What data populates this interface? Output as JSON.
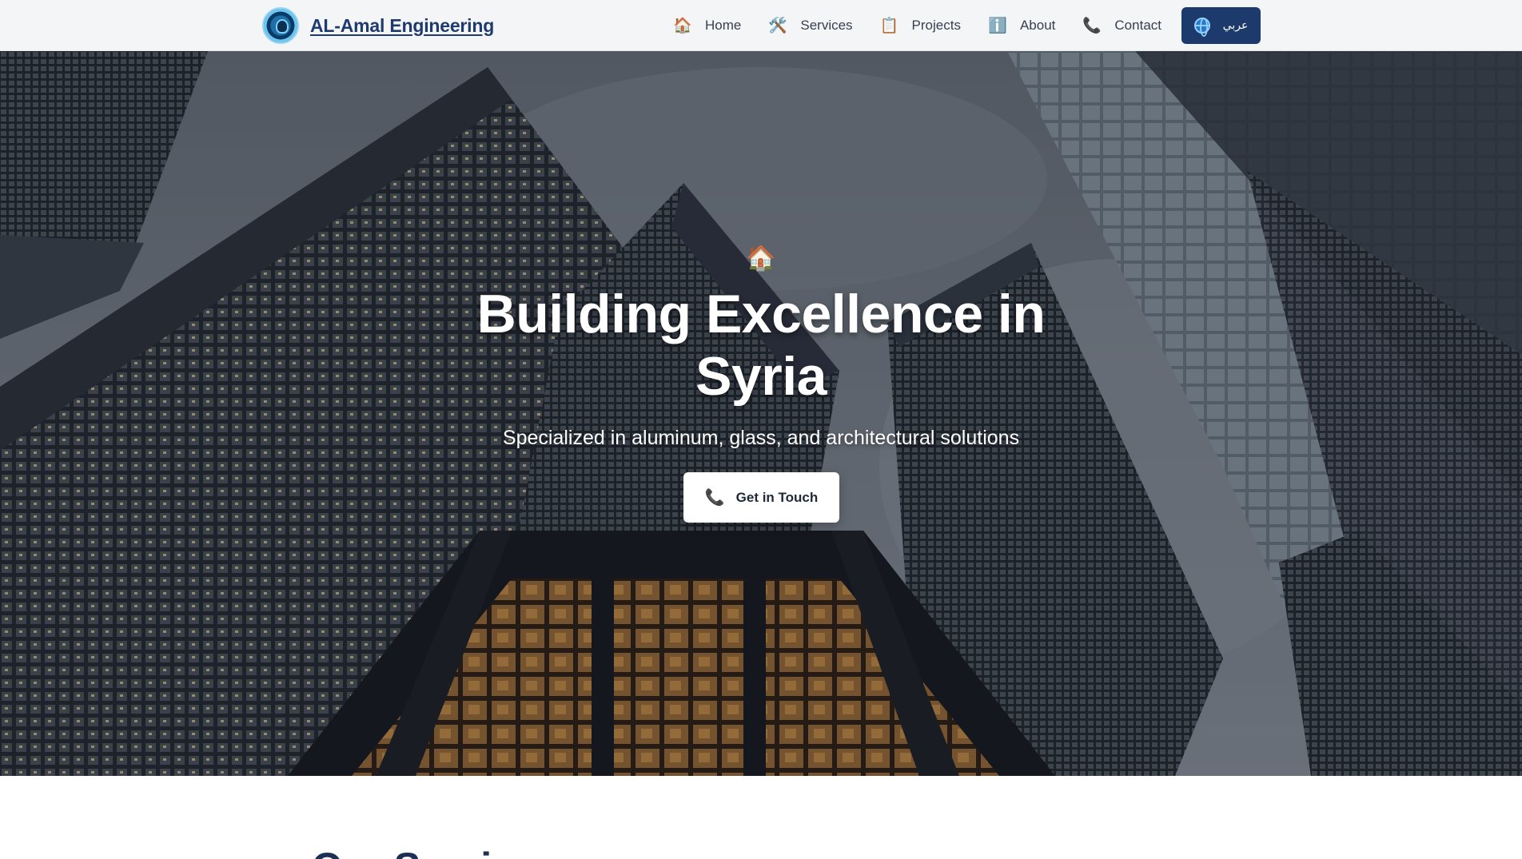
{
  "header": {
    "brand_name": "AL-Amal Engineering",
    "logo_icon": "company-logo-icon",
    "nav": [
      {
        "icon": "🏠",
        "icon_name": "home-icon",
        "label": "Home"
      },
      {
        "icon": "🛠️",
        "icon_name": "tools-icon",
        "label": "Services"
      },
      {
        "icon": "📋",
        "icon_name": "clipboard-icon",
        "label": "Projects"
      },
      {
        "icon": "ℹ️",
        "icon_name": "info-icon",
        "label": "About"
      },
      {
        "icon": "📞",
        "icon_name": "phone-icon",
        "label": "Contact"
      }
    ],
    "language_button": {
      "icon_name": "globe-icon",
      "label": "عربي"
    }
  },
  "hero": {
    "icon": "🏠",
    "icon_name": "home-icon",
    "title": "Building Excellence in Syria",
    "subtitle": "Specialized in aluminum, glass, and architectural solutions",
    "cta": {
      "icon": "📞",
      "icon_name": "phone-icon",
      "label": "Get in Touch"
    }
  },
  "services_section": {
    "heading": "Our Services"
  },
  "colors": {
    "brand_navy": "#1c3a6b",
    "nav_background": "#f4f5f7",
    "hero_text": "#ffffff"
  }
}
